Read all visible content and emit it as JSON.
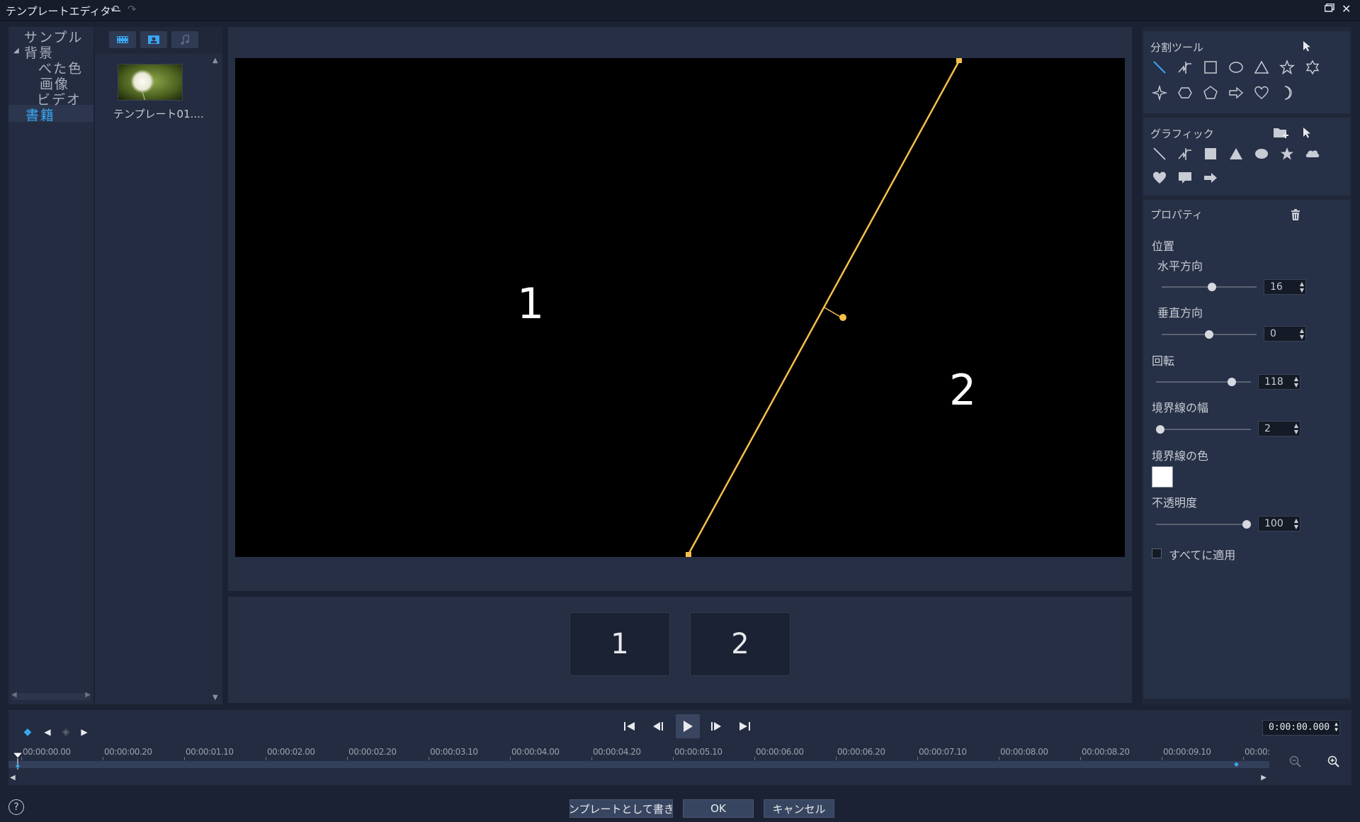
{
  "window": {
    "title": "テンプレートエディター",
    "undo_icon": "↶",
    "redo_icon": "↷",
    "restore_icon": "🗗",
    "close_icon": "✕"
  },
  "tree": {
    "items": [
      {
        "label": "サンプル"
      },
      {
        "label": "背景"
      },
      {
        "label": "べた色"
      },
      {
        "label": "画像"
      },
      {
        "label": "ビデオ"
      },
      {
        "label": "書籍"
      }
    ],
    "selected": "書籍"
  },
  "library": {
    "tabs": [
      "video-tab",
      "photo-tab",
      "audio-tab"
    ],
    "active_tab": "video-tab",
    "items": [
      {
        "label": "テンプレート01...."
      }
    ]
  },
  "preview": {
    "regions": [
      "1",
      "2"
    ],
    "split_line_color": "#f5c04a"
  },
  "strip": {
    "thumbs": [
      "1",
      "2"
    ]
  },
  "props": {
    "split_tools_title": "分割ツール",
    "graphics_title": "グラフィック",
    "properties_title": "プロパティ",
    "position_label": "位置",
    "horizontal_label": "水平方向",
    "horizontal_value": "16",
    "horizontal_level": 0.53,
    "vertical_label": "垂直方向",
    "vertical_value": "0",
    "vertical_level": 0.5,
    "rotation_label": "回転",
    "rotation_value": "118",
    "rotation_level": 0.83,
    "border_width_label": "境界線の幅",
    "border_width_value": "2",
    "border_width_level": 0.0,
    "border_color_label": "境界線の色",
    "border_color": "#ffffff",
    "opacity_label": "不透明度",
    "opacity_value": "100",
    "opacity_level": 1.0,
    "apply_all_label": "すべてに適用",
    "apply_all_checked": false
  },
  "timeline": {
    "ticks": [
      "00:00:00.00",
      "00:00:00.20",
      "00:00:01.10",
      "00:00:02.00",
      "00:00:02.20",
      "00:00:03.10",
      "00:00:04.00",
      "00:00:04.20",
      "00:00:05.10",
      "00:00:06.00",
      "00:00:06.20",
      "00:00:07.10",
      "00:00:08.00",
      "00:00:08.20",
      "00:00:09.10",
      "00:00:"
    ],
    "timecode": "0:00:00.000",
    "zoom_out_icon": "zoom-out-icon",
    "zoom_in_icon": "zoom-in-icon"
  },
  "buttons": {
    "save_template": "テンプレートとして書き...",
    "ok": "OK",
    "cancel": "キャンセル",
    "help": "?"
  }
}
